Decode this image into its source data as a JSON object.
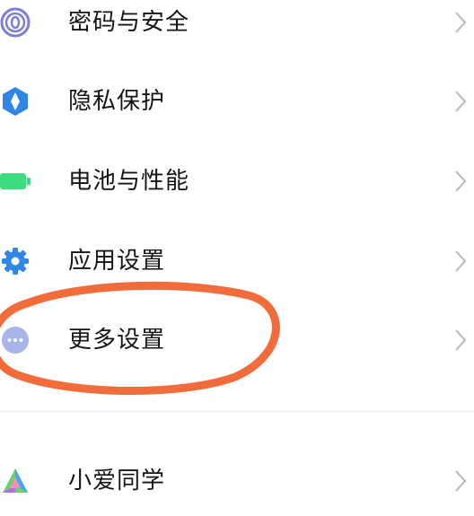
{
  "settings": {
    "items": [
      {
        "label": "密码与安全",
        "icon": "fingerprint-icon",
        "icon_color": "#7b7fd6"
      },
      {
        "label": "隐私保护",
        "icon": "privacy-shield-icon",
        "icon_color": "#2f86e6"
      },
      {
        "label": "电池与性能",
        "icon": "battery-icon",
        "icon_color": "#3ddc7e"
      },
      {
        "label": "应用设置",
        "icon": "gear-icon",
        "icon_color": "#2f86e6"
      },
      {
        "label": "更多设置",
        "icon": "more-dots-icon",
        "icon_color": "#a9b4ea"
      },
      {
        "label": "小爱同学",
        "icon": "xiaoai-icon",
        "icon_color": "#6fd16b"
      }
    ]
  },
  "annotation": {
    "shape": "ellipse",
    "color": "#f26b3a",
    "target": "更多设置"
  },
  "colors": {
    "text": "#151515",
    "chevron": "#b7b7b7",
    "divider": "#eeeeee"
  }
}
